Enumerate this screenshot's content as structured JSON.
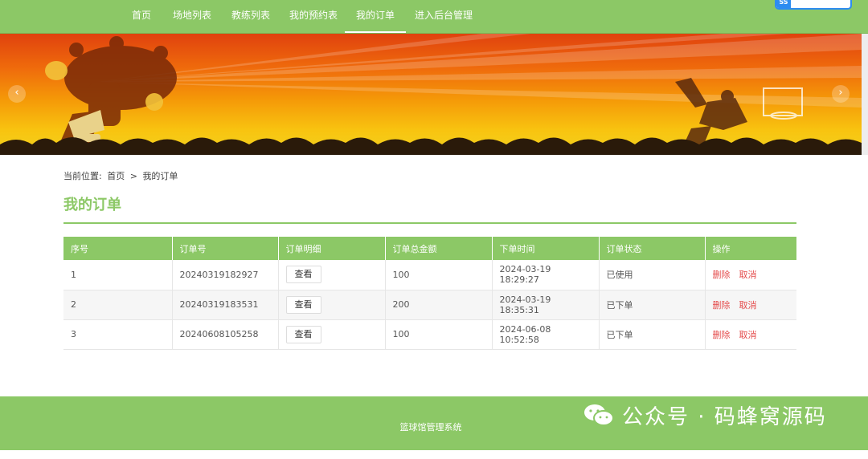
{
  "nav": {
    "items": [
      {
        "label": "首页"
      },
      {
        "label": "场地列表"
      },
      {
        "label": "教练列表"
      },
      {
        "label": "我的预约表"
      },
      {
        "label": "我的订单"
      },
      {
        "label": "进入后台管理"
      }
    ],
    "active": "我的订单",
    "badge_logo": "SS"
  },
  "colors": {
    "theme_green": "#8cc866",
    "delete_red": "#e44b4b"
  },
  "breadcrumb": {
    "prefix": "当前位置:",
    "home": "首页",
    "separator": ">",
    "current": "我的订单"
  },
  "page": {
    "title": "我的订单"
  },
  "table": {
    "headers": [
      "序号",
      "订单号",
      "订单明细",
      "订单总金额",
      "下单时间",
      "订单状态",
      "操作"
    ],
    "rows": [
      {
        "idx": "1",
        "order_no": "20240319182927",
        "detail": "查看",
        "amount": "100",
        "time": "2024-03-19 18:29:27",
        "status": "已使用",
        "op_delete": "删除",
        "op_cancel": "取消"
      },
      {
        "idx": "2",
        "order_no": "20240319183531",
        "detail": "查看",
        "amount": "200",
        "time": "2024-03-19 18:35:31",
        "status": "已下单",
        "op_delete": "删除",
        "op_cancel": "取消"
      },
      {
        "idx": "3",
        "order_no": "20240608105258",
        "detail": "查看",
        "amount": "100",
        "time": "2024-06-08 10:52:58",
        "status": "已下单",
        "op_delete": "删除",
        "op_cancel": "取消"
      }
    ]
  },
  "banner": {
    "prev_icon": "‹",
    "next_icon": "›"
  },
  "footer": {
    "text": "篮球馆管理系统"
  },
  "watermark": {
    "text": "公众号 · 码蜂窝源码"
  }
}
